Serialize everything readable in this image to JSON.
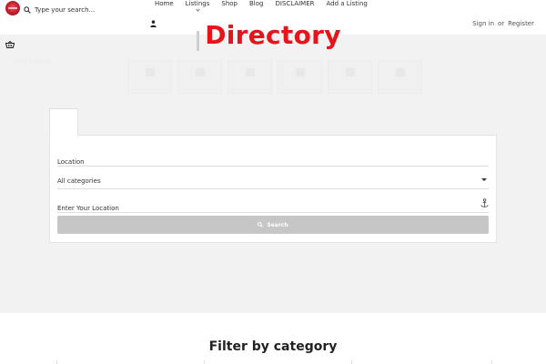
{
  "header": {
    "search_placeholder": "Type your search...",
    "nav": [
      {
        "label": "Home"
      },
      {
        "label": "Listings"
      },
      {
        "label": "Shop"
      },
      {
        "label": "Blog"
      },
      {
        "label": "DISCLAIMER"
      },
      {
        "label": "Add a Listing"
      }
    ],
    "auth": {
      "sign_in": "Sign in",
      "or": "or",
      "register": "Register"
    }
  },
  "hero": {
    "title": "Directory",
    "faint_link": "Add Listing"
  },
  "search_form": {
    "location_placeholder": "Location",
    "category_selected": "All categories",
    "address_placeholder": "Enter Your Location",
    "button_label": "Search"
  },
  "filter": {
    "title": "Filter by category"
  },
  "colors": {
    "brand_red": "#e8141b",
    "hero_bg": "#f2f2f2",
    "button_bg": "#c6c6c6"
  }
}
